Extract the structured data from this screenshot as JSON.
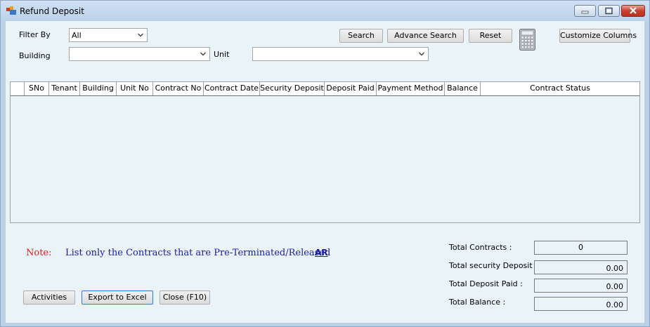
{
  "window": {
    "title": "Refund Deposit"
  },
  "filters": {
    "filter_by_label": "Filter By",
    "filter_by_value": "All",
    "building_label": "Building",
    "building_value": "",
    "unit_label": "Unit",
    "unit_value": ""
  },
  "toolbar": {
    "search": "Search",
    "advance_search": "Advance Search",
    "reset": "Reset",
    "customize_columns": "Customize Columns"
  },
  "grid": {
    "columns": [
      "SNo",
      "Tenant",
      "Building",
      "Unit No",
      "Contract No",
      "Contract Date",
      "Security Deposit",
      "Deposit Paid",
      "Payment Method",
      "Balance",
      "Contract Status"
    ]
  },
  "note": {
    "label": "Note:",
    "text": "List only the Contracts that are Pre-Terminated/Released",
    "link": "AR"
  },
  "actions": {
    "activities": "Activities",
    "export": "Export to Excel",
    "close": "Close (F10)"
  },
  "totals": {
    "contracts_label": "Total Contracts :",
    "contracts_value": "0",
    "security_label": "Total security Deposit :",
    "security_value": "0.00",
    "paid_label": "Total Deposit Paid :",
    "paid_value": "0.00",
    "balance_label": "Total Balance :",
    "balance_value": "0.00"
  }
}
